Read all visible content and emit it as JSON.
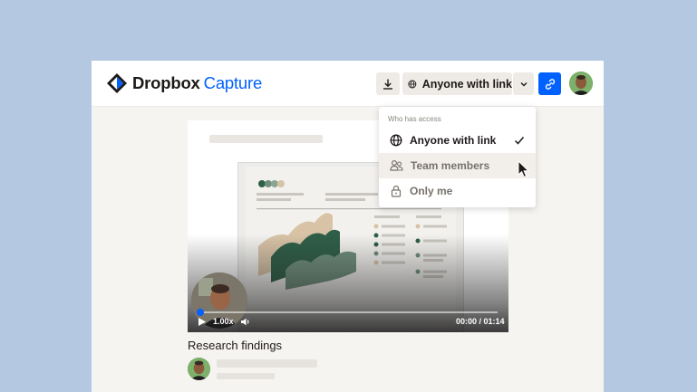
{
  "app": {
    "brand": "Dropbox",
    "product": "Capture"
  },
  "toolbar": {
    "share_label": "Anyone with link",
    "icons": [
      "download-icon",
      "globe-icon",
      "chevron-down-icon",
      "link-icon"
    ]
  },
  "access_menu": {
    "header": "Who has access",
    "options": [
      {
        "label": "Anyone with link",
        "icon": "globe-icon",
        "selected": true
      },
      {
        "label": "Team members",
        "icon": "team-icon",
        "selected": false,
        "hovered": true
      },
      {
        "label": "Only me",
        "icon": "lock-icon",
        "selected": false
      }
    ]
  },
  "video": {
    "speed": "1.00x",
    "time": "00:00 / 01:14",
    "progress": 0.01,
    "title": "Research findings"
  },
  "colors": {
    "background": "#b5c8e2",
    "accent": "#0061fe",
    "chart_tan": "#d8c3a6",
    "chart_dark_green": "#2f5f48",
    "chart_sage": "#6f8f7c"
  }
}
